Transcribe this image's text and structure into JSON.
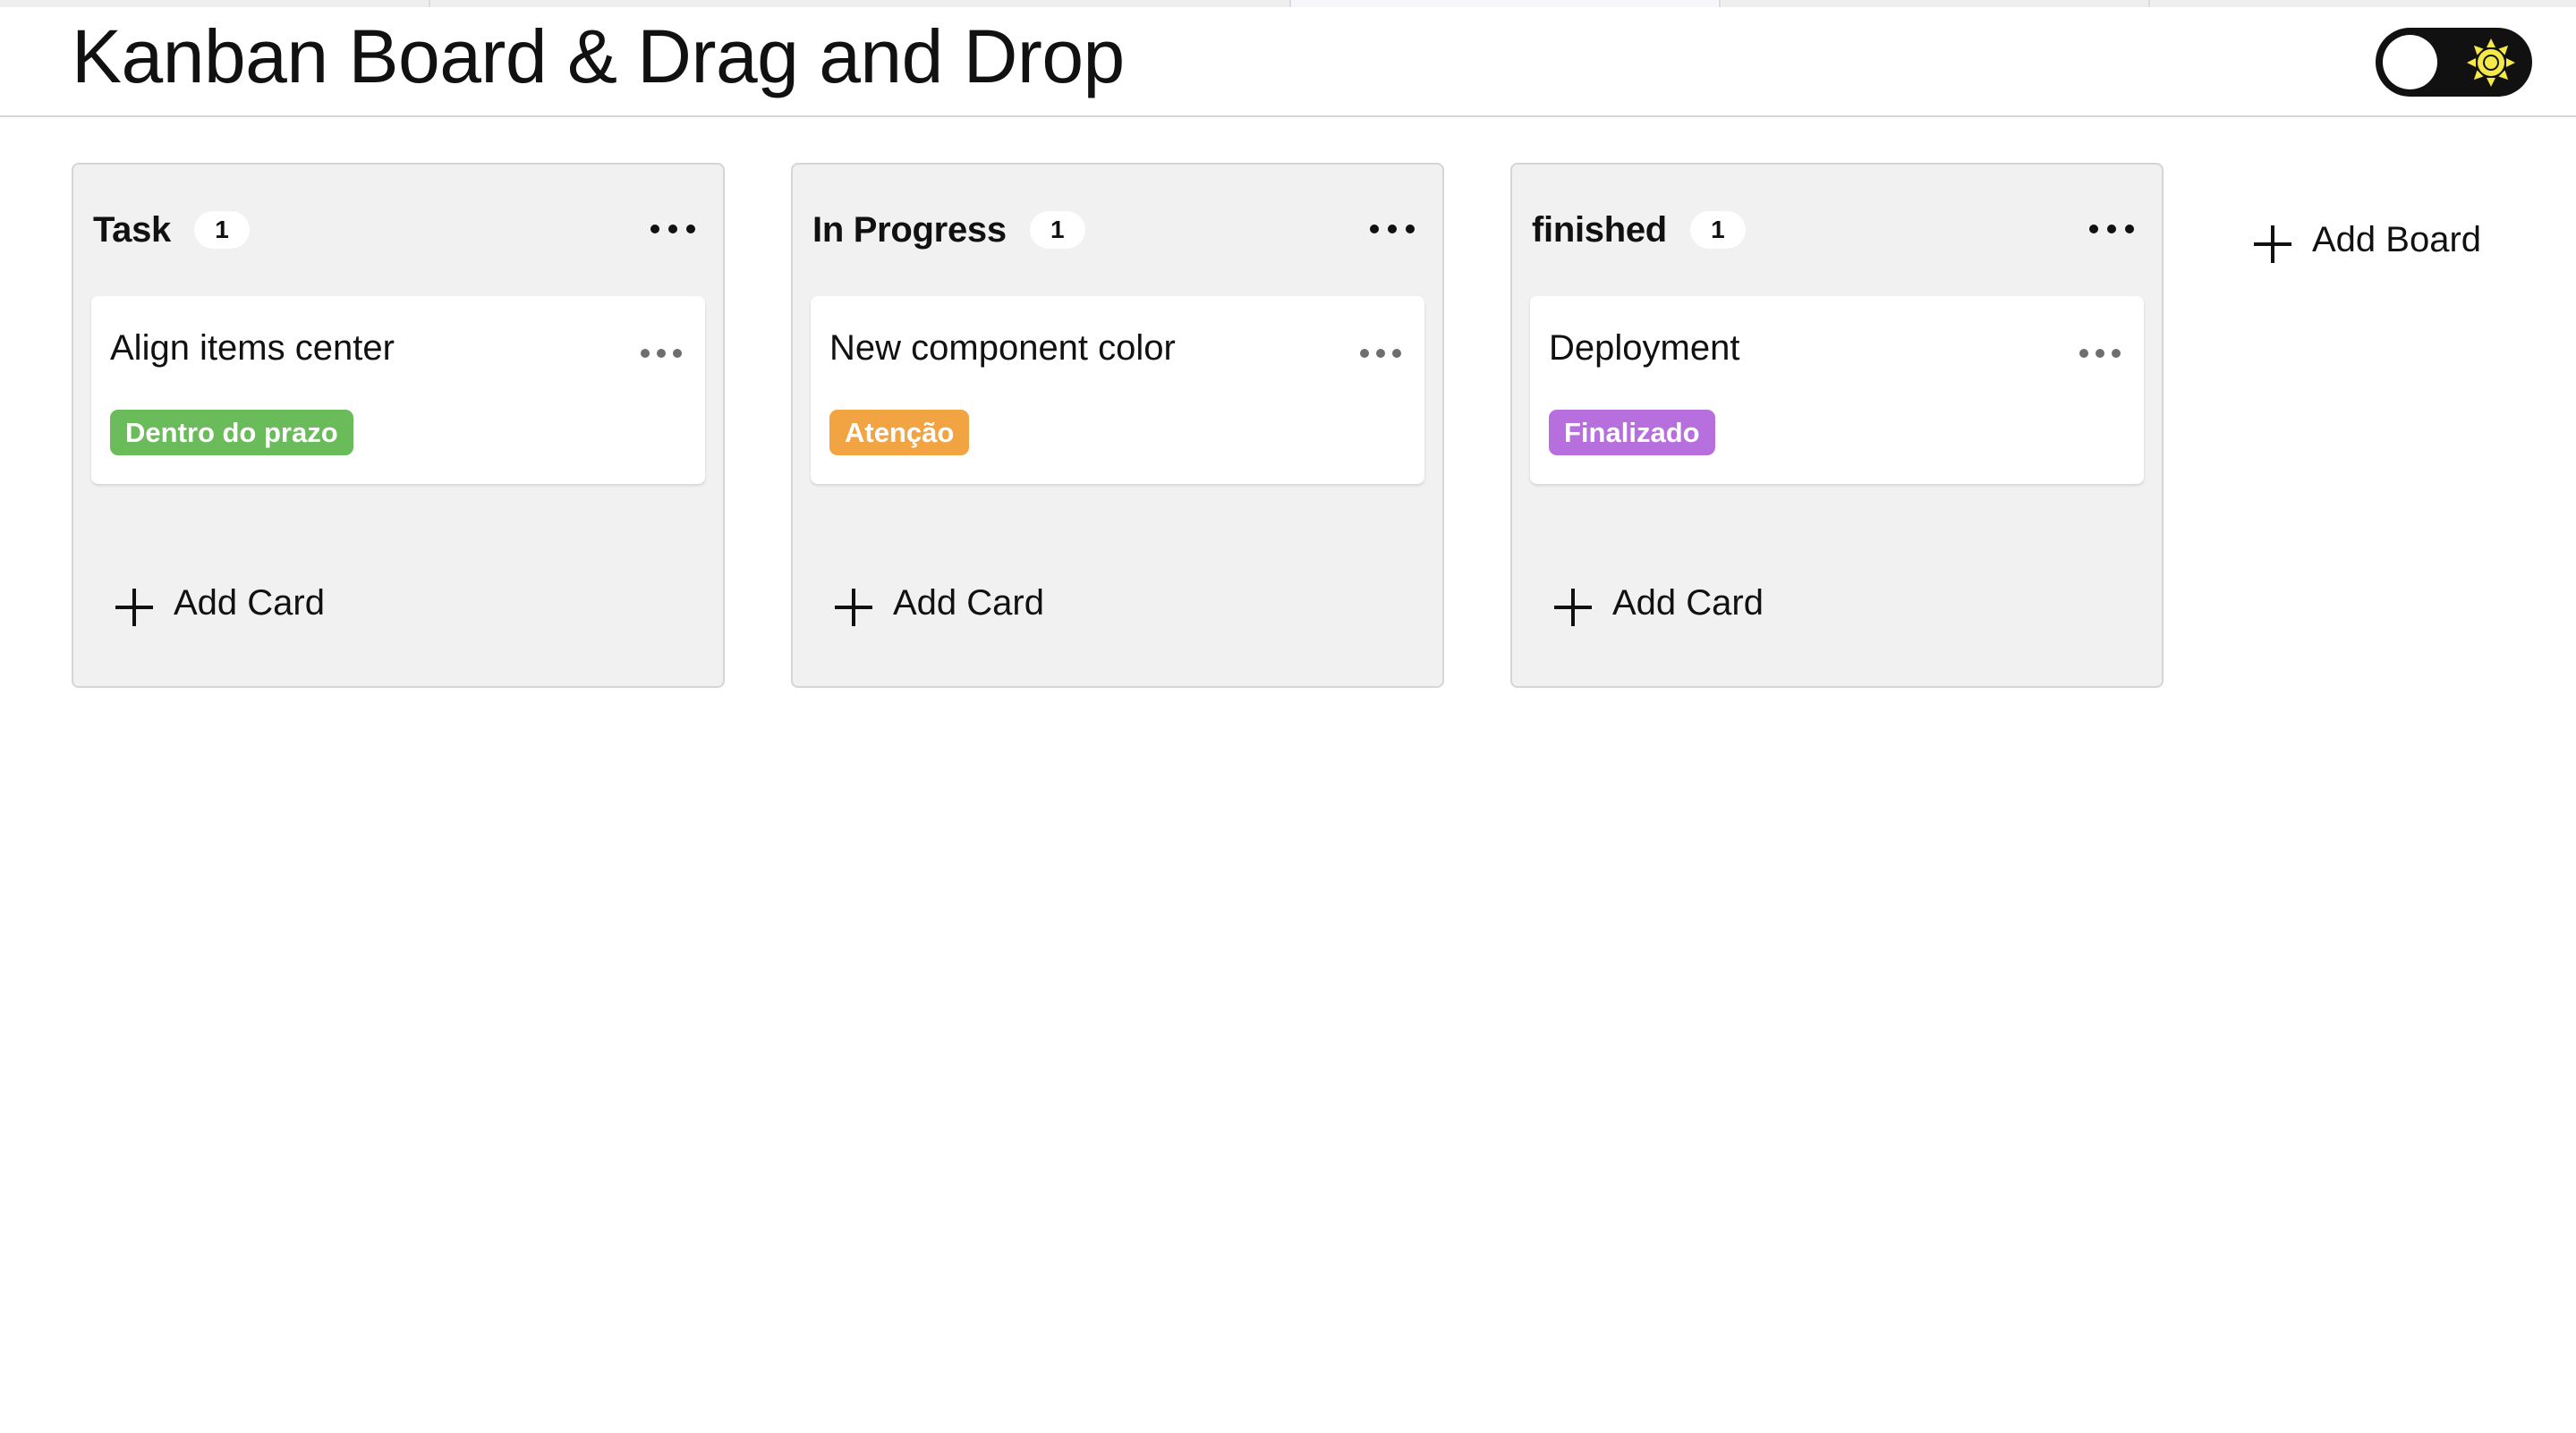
{
  "header": {
    "title": "Kanban Board & Drag and Drop"
  },
  "theme_toggle": {
    "state": "light",
    "icon": "sun-icon",
    "track_color": "#111111",
    "sun_color": "#f5e94a"
  },
  "boards": [
    {
      "title": "Task",
      "count": "1",
      "cards": [
        {
          "title": "Align items center",
          "tag": "Dentro do prazo",
          "tag_color": "#6abc5a"
        }
      ],
      "add_card_label": "Add Card"
    },
    {
      "title": "In Progress",
      "count": "1",
      "cards": [
        {
          "title": "New component color",
          "tag": "Atenção",
          "tag_color": "#f2a443"
        }
      ],
      "add_card_label": "Add Card"
    },
    {
      "title": "finished",
      "count": "1",
      "cards": [
        {
          "title": "Deployment",
          "tag": "Finalizado",
          "tag_color": "#b86fde"
        }
      ],
      "add_card_label": "Add Card"
    }
  ],
  "add_board_label": "Add Board",
  "icons": {
    "menu": "more-horizontal-icon",
    "add": "plus-icon",
    "theme": "sun-icon"
  },
  "colors": {
    "board_background": "#f1f1f1",
    "card_background": "#ffffff",
    "menu_dots_board": "#111111",
    "menu_dots_card": "#6e6e6e"
  }
}
